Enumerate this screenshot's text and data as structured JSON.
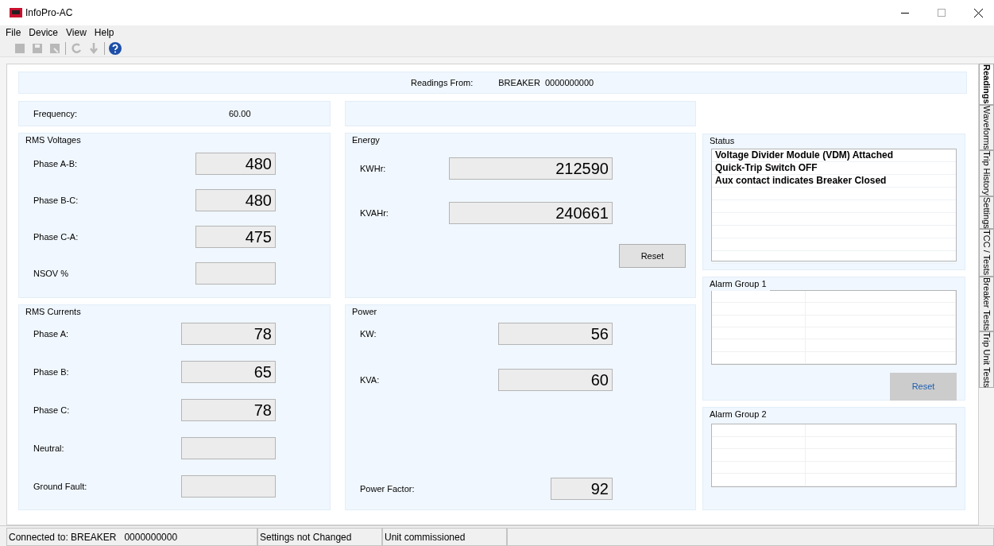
{
  "window": {
    "title": "InfoPro-AC"
  },
  "menu": [
    "File",
    "Device",
    "View",
    "Help"
  ],
  "toolbar": [
    {
      "kind": "open",
      "disabled": true
    },
    {
      "kind": "save",
      "disabled": true
    },
    {
      "kind": "save-as",
      "disabled": true
    },
    {
      "kind": "refresh",
      "disabled": true
    },
    {
      "kind": "download",
      "disabled": true
    },
    {
      "kind": "help",
      "disabled": false
    }
  ],
  "readings_from": {
    "label": "Readings From:",
    "value": "BREAKER  0000000000"
  },
  "frequency": {
    "label": "Frequency:",
    "value": "60.00"
  },
  "rms_voltages": {
    "title": "RMS Voltages",
    "fields": [
      {
        "label": "Phase A-B:",
        "value": "480"
      },
      {
        "label": "Phase B-C:",
        "value": "480"
      },
      {
        "label": "Phase C-A:",
        "value": "475"
      },
      {
        "label": "NSOV %"
      }
    ]
  },
  "rms_currents": {
    "title": "RMS Currents",
    "fields": [
      {
        "label": "Phase A:",
        "value": "78"
      },
      {
        "label": "Phase B:",
        "value": "65"
      },
      {
        "label": "Phase C:",
        "value": "78"
      },
      {
        "label": "Neutral:"
      },
      {
        "label": "Ground Fault:"
      }
    ]
  },
  "energy": {
    "title": "Energy",
    "fields": [
      {
        "label": "KWHr:",
        "value": "212590"
      },
      {
        "label": "KVAHr:",
        "value": "240661"
      }
    ],
    "button": "Reset"
  },
  "power": {
    "title": "Power",
    "fields": [
      {
        "label": "KW:",
        "value": "56"
      },
      {
        "label": "KVA:",
        "value": "60"
      }
    ],
    "power_factor": {
      "label": "Power Factor:",
      "value": "92"
    }
  },
  "status": {
    "title": "Status",
    "items": [
      "Voltage Divider Module (VDM) Attached",
      "Quick-Trip Switch OFF",
      "Aux contact indicates Breaker Closed"
    ]
  },
  "alarm_group_1": {
    "title": "Alarm Group 1",
    "button": "Reset"
  },
  "alarm_group_2": {
    "title": "Alarm Group 2"
  },
  "side_tabs": [
    {
      "label": "Readings",
      "selected": true
    },
    {
      "label": "Waveforms",
      "selected": false
    },
    {
      "label": "Trip History",
      "selected": false
    },
    {
      "label": "Settings",
      "selected": false
    },
    {
      "label": "TCC / Tests",
      "selected": false
    },
    {
      "label": "Breaker Tests",
      "selected": false
    },
    {
      "label": "Trip Unit Tests",
      "selected": false
    }
  ],
  "status_bar": [
    "Connected to: BREAKER   0000000000",
    "Settings not Changed",
    "Unit commissioned"
  ]
}
